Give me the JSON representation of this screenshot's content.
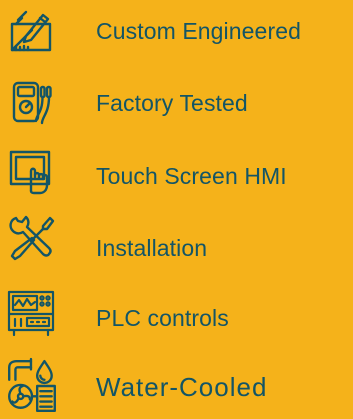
{
  "colors": {
    "background": "#F5B21A",
    "text": "#135566",
    "icon": "#135566"
  },
  "features": [
    {
      "label": "Custom Engineered",
      "icon": "design-tools-icon"
    },
    {
      "label": "Factory Tested",
      "icon": "multimeter-icon"
    },
    {
      "label": "Touch Screen HMI",
      "icon": "touch-screen-icon"
    },
    {
      "label": "Installation",
      "icon": "wrench-screwdriver-icon"
    },
    {
      "label": "PLC controls",
      "icon": "control-panel-icon"
    },
    {
      "label": "Water-Cooled",
      "icon": "water-cooled-icon"
    }
  ]
}
